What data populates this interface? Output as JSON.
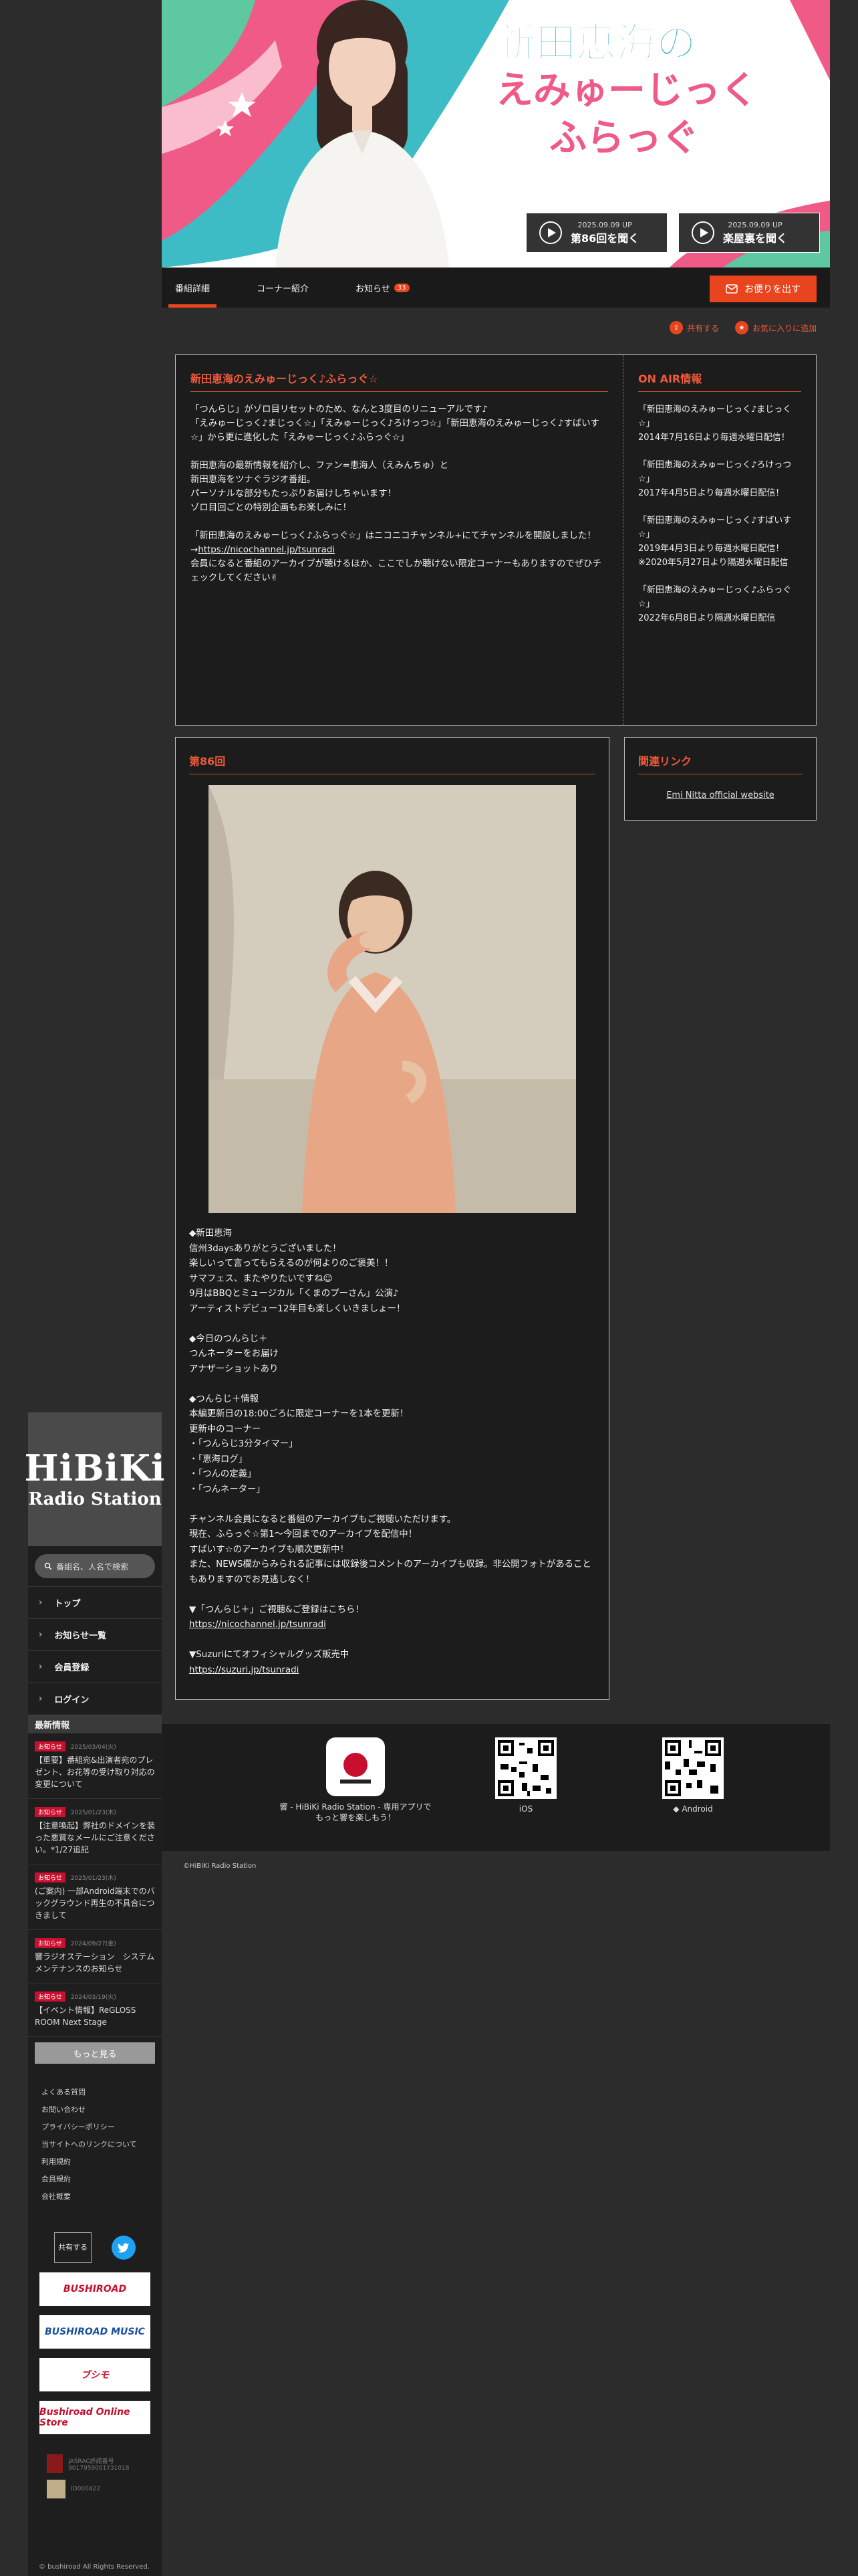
{
  "sidebar": {
    "logo_line1": "HiBiKi",
    "logo_line2": "Radio Station",
    "search_placeholder": "番組名、人名で検索",
    "nav": [
      "トップ",
      "お知らせ一覧",
      "会員登録",
      "ログイン"
    ],
    "news_heading": "最新情報",
    "news": [
      {
        "badge": "お知らせ",
        "date": "2025/03/04(火)",
        "text": "【重要】番組宛&出演者宛のプレゼント、お花等の受け取り対応の変更について"
      },
      {
        "badge": "お知らせ",
        "date": "2025/01/23(木)",
        "text": "【注意喚起】弊社のドメインを装った悪質なメールにご注意ください。*1/27追記"
      },
      {
        "badge": "お知らせ",
        "date": "2025/01/23(木)",
        "text": "(ご案内) 一部Android端末でのバックグラウンド再生の不具合につきまして"
      },
      {
        "badge": "お知らせ",
        "date": "2024/09/27(金)",
        "text": "響ラジオステーション　システムメンテナンスのお知らせ"
      },
      {
        "badge": "お知らせ",
        "date": "2024/03/19(火)",
        "text": "【イベント情報】ReGLOSS ROOM Next Stage"
      }
    ],
    "more": "もっと見る",
    "footer_links": [
      "よくある質問",
      "お問い合わせ",
      "プライバシーポリシー",
      "当サイトへのリンクについて",
      "利用規約",
      "会員規約",
      "会社概要"
    ],
    "share": "共有する",
    "banners": [
      "BUSHIROAD",
      "BUSHIROAD MUSIC",
      "ブシモ",
      "Bushiroad Online Store"
    ],
    "jasrac": "JASRAC許諾番号 9017959001Y31018",
    "nextone": "ID000422",
    "copyright": "© bushiroad All Rights Reserved."
  },
  "hero": {
    "title_line1": "新田恵海の",
    "title_line2": "えみゅーじっく",
    "title_line3": "ふらっぐ",
    "ep_btn1_date": "2025.09.09 UP",
    "ep_btn1_label": "第86回を聞く",
    "ep_btn2_date": "2025.09.09 UP",
    "ep_btn2_label": "楽屋裏を聞く"
  },
  "tabs": [
    {
      "label": "番組詳細",
      "active": true
    },
    {
      "label": "コーナー紹介"
    },
    {
      "label": "お知らせ",
      "count": "33"
    }
  ],
  "letter_btn": "お便りを出す",
  "actions": {
    "share": "共有する",
    "favorite": "お気に入りに追加"
  },
  "program": {
    "title": "新田恵海のえみゅーじっく♪ふらっぐ☆",
    "description": "「つんらじ」がゾロ目リセットのため、なんと3度目のリニューアルです♪\n「えみゅーじっく♪まじっく☆」「えみゅーじっく♪ろけっつ☆」「新田恵海のえみゅーじっく♪すばいす☆」から更に進化した「えみゅーじっく♪ふらっぐ☆」\n\n新田恵海の最新情報を紹介し、ファン=恵海人（えみんちゅ）と\n新田恵海をツナぐラジオ番組。\nパーソナルな部分もたっぷりお届けしちゃいます！\nゾロ目回ごとの特別企画もお楽しみに！\n\n「新田恵海のえみゅーじっく♪ふらっぐ☆」はニコニコチャンネル+にてチャンネルを開設しました！\n→",
    "link": "https://nicochannel.jp/tsunradi",
    "description2": "会員になると番組のアーカイブが聴けるほか、ここでしか聴けない限定コーナーもありますのでぜひチェックしてください✌"
  },
  "onair": {
    "title": "ON AIR情報",
    "entries": [
      "「新田恵海のえみゅーじっく♪まじっく☆」\n2014年7月16日より毎週水曜日配信！",
      "「新田恵海のえみゅーじっく♪ろけっつ☆」\n2017年4月5日より毎週水曜日配信！",
      "「新田恵海のえみゅーじっく♪すばいす☆」\n2019年4月3日より毎週水曜日配信！\n※2020年5月27日より隔週水曜日配信",
      "「新田恵海のえみゅーじっく♪ふらっぐ☆」\n2022年6月8日より隔週水曜日配信"
    ]
  },
  "episode": {
    "title": "第86回",
    "text": "◆新田恵海\n信州3daysありがとうございました！\n楽しいって言ってもらえるのが何よりのご褒美！！\nサマフェス、またやりたいですね☺\n9月はBBQとミュージカル「くまのプーさん」公演♪\nアーティストデビュー12年目も楽しくいきましょー！\n\n◆今日のつんらじ＋\nつんネーターをお届け\nアナザーショットあり\n\n◆つんらじ＋情報\n本編更新日の18:00ごろに限定コーナーを1本を更新！\n更新中のコーナー\n・「つんらじ3分タイマー」\n・「恵海ログ」\n・「つんの定義」\n・「つんネーター」\n\nチャンネル会員になると番組のアーカイブもご視聴いただけます。\n現在、ふらっぐ☆第1〜今回までのアーカイブを配信中！\nすばいす☆のアーカイブも順次更新中！\nまた、NEWS欄からみられる記事には収録後コメントのアーカイブも収録。非公開フォトがあることもありますのでお見逃しなく！\n\n▼「つんらじ＋」ご視聴&ご登録はこちら！",
    "link1": "https://nicochannel.jp/tsunradi",
    "text2": "▼Suzuriにてオフィシャルグッズ販売中",
    "link2": "https://suzuri.jp/tsunradi"
  },
  "related": {
    "title": "関連リンク",
    "link": "Emi Nitta official website"
  },
  "apps": {
    "app_label": "響 - HiBiKi Radio Station - 専用アプリで\nもっと響を楽しもう！",
    "ios": "iOS",
    "android": "Android"
  },
  "copyright": "©HiBiKi Radio Station",
  "colors": {
    "accent": "#e8451e",
    "background": "#2c2c2c"
  }
}
